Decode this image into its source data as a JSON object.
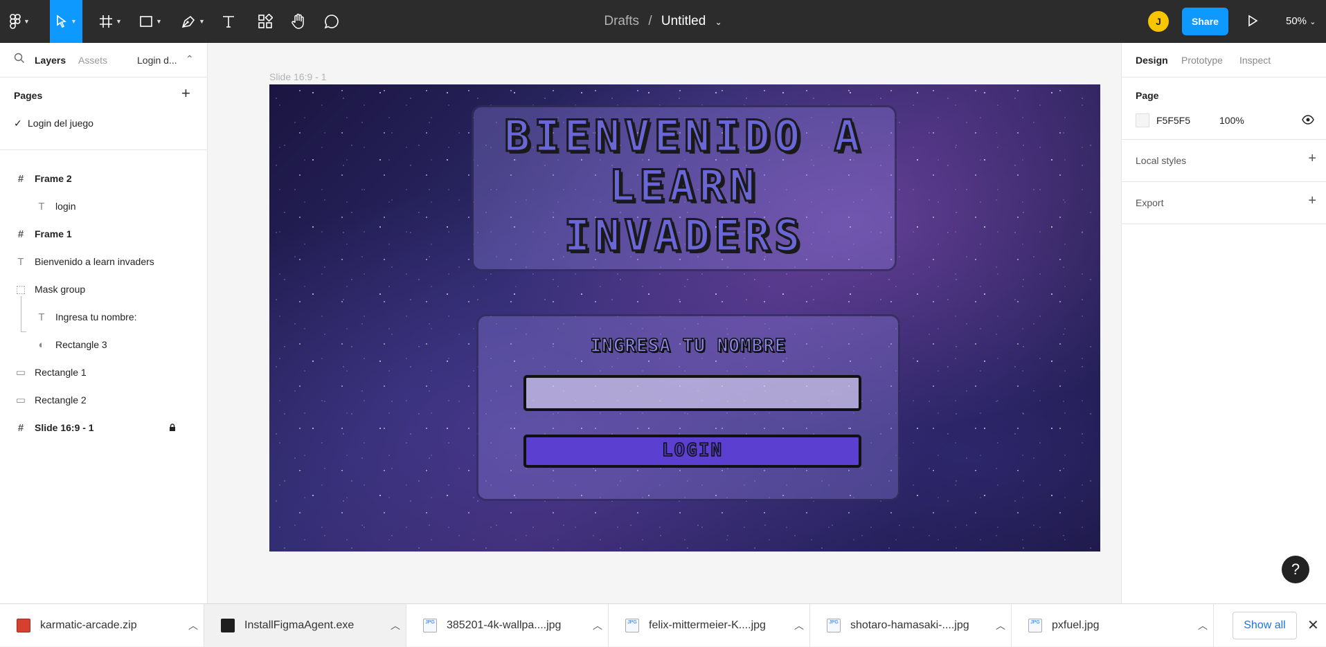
{
  "toolbar": {
    "breadcrumb_parent": "Drafts",
    "separator": "/",
    "file_name": "Untitled",
    "avatar_letter": "J",
    "share_label": "Share",
    "zoom": "50%"
  },
  "left_panel": {
    "tabs": [
      "Layers",
      "Assets"
    ],
    "page_selector": "Login d...",
    "pages_title": "Pages",
    "pages": [
      "Login del juego"
    ],
    "layers": [
      {
        "label": "Frame 2",
        "icon": "frame-icon"
      },
      {
        "label": "login",
        "icon": "text-icon"
      },
      {
        "label": "Frame 1",
        "icon": "frame-icon"
      },
      {
        "label": "Bienvenido a learn invaders",
        "icon": "text-icon"
      },
      {
        "label": "Mask group",
        "icon": "mask-group-icon"
      },
      {
        "label": "Ingresa tu nombre:",
        "icon": "text-icon"
      },
      {
        "label": "Rectangle 3",
        "icon": "mask-icon"
      },
      {
        "label": "Rectangle 1",
        "icon": "rectangle-icon"
      },
      {
        "label": "Rectangle 2",
        "icon": "rectangle-icon"
      },
      {
        "label": "Slide 16:9 - 1",
        "icon": "frame-icon"
      }
    ]
  },
  "right_panel": {
    "tabs": [
      "Design",
      "Prototype",
      "Inspect"
    ],
    "page_section": "Page",
    "page_color": "F5F5F5",
    "page_opacity": "100%",
    "local_styles": "Local styles",
    "export": "Export"
  },
  "canvas": {
    "slide_label": "Slide 16:9 - 1",
    "title_lines": [
      "BIENVENIDO A",
      "LEARN",
      "INVADERS"
    ],
    "subtitle": "INGRESA TU NOMBRE",
    "login_label": "LOGIN"
  },
  "help_label": "?",
  "downloads": {
    "items": [
      "karmatic-arcade.zip",
      "InstallFigmaAgent.exe",
      "385201-4k-wallpa....jpg",
      "felix-mittermeier-K....jpg",
      "shotaro-hamasaki-....jpg",
      "pxfuel.jpg"
    ],
    "show_all": "Show all"
  },
  "colors": {
    "accent": "#0d99ff",
    "toolbar_bg": "#2c2c2c",
    "avatar": "#f7c600"
  }
}
